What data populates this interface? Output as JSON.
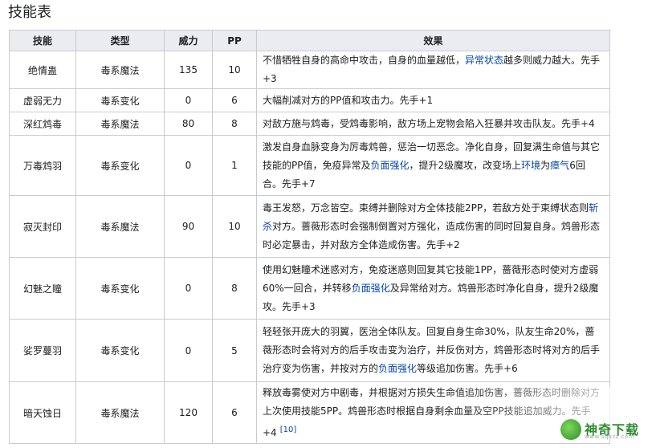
{
  "section_title": "技能表",
  "headers": {
    "skill": "技能",
    "type": "类型",
    "power": "威力",
    "pp": "PP",
    "effect": "效果"
  },
  "rows": [
    {
      "name": "绝情蛊",
      "type": "毒系魔法",
      "power": "135",
      "pp": "10",
      "effect": [
        {
          "t": "不惜牺牲自身的高命中攻击，自身的血量越低，"
        },
        {
          "t": "异常状态",
          "link": true
        },
        {
          "t": "越多则威力越大。先手+3"
        }
      ]
    },
    {
      "name": "虚弱无力",
      "type": "毒系变化",
      "power": "0",
      "pp": "6",
      "effect": [
        {
          "t": "大幅削减对方的PP值和攻击力。先手+1"
        }
      ]
    },
    {
      "name": "深红鸩毒",
      "type": "毒系魔法",
      "power": "80",
      "pp": "8",
      "effect": [
        {
          "t": "对敌方施与鸩毒，受鸩毒影响，敌方场上宠物会陷入狂暴并攻击队友。先手+4"
        }
      ]
    },
    {
      "name": "万毒鸩羽",
      "type": "毒系变化",
      "power": "0",
      "pp": "1",
      "effect": [
        {
          "t": "激发自身血脉变身为厉毒鸩兽，惩治一切恶念。净化自身，回复满生命值与其它技能的PP值，免疫异常及"
        },
        {
          "t": "负面强化",
          "link": true
        },
        {
          "t": "，提升2级魔攻，改变场上"
        },
        {
          "t": "环境",
          "link": true
        },
        {
          "t": "为"
        },
        {
          "t": "瘴气",
          "link": true
        },
        {
          "t": "6回合。先手+7"
        }
      ]
    },
    {
      "name": "寂灭封印",
      "type": "毒系魔法",
      "power": "90",
      "pp": "10",
      "effect": [
        {
          "t": "毒王发怒，万念皆空。束缚并删除对方全体技能2PP，若敌方处于束缚状态则"
        },
        {
          "t": "斩杀",
          "link": true
        },
        {
          "t": "对方。蔷薇形态时会强制倒置对方强化，造成伤害的同时回复自身。鸩兽形态时必定暴击，并对敌方全体造成伤害。先手+2"
        }
      ]
    },
    {
      "name": "幻魅之瞳",
      "type": "毒系变化",
      "power": "0",
      "pp": "8",
      "effect": [
        {
          "t": "使用幻魅瞳术迷惑对方，免疫迷惑则回复其它技能1PP，蔷薇形态时使对方虚弱60%一回合，并转移"
        },
        {
          "t": "负面强化",
          "link": true
        },
        {
          "t": "及异常给对方。鸩兽形态时净化自身，提升2级魔攻。先手+3"
        }
      ]
    },
    {
      "name": "娑罗蔓羽",
      "type": "毒系变化",
      "power": "0",
      "pp": "5",
      "effect": [
        {
          "t": "轻轻张开庞大的羽翼，医治全体队友。回复自身生命30%，队友生命20%，蔷薇形态时会将对方的后手攻击变为治疗，并反伤对方，鸩兽形态时将对方的后手治疗变为伤害，并按对方的"
        },
        {
          "t": "负面强化",
          "link": true
        },
        {
          "t": "等级追加伤害。先手+6"
        }
      ]
    },
    {
      "name": "暗天蚀日",
      "type": "毒系魔法",
      "power": "120",
      "pp": "6",
      "effect": [
        {
          "t": "释放毒雾使对方中剧毒，并根据对方损失生命值追加伤害，蔷薇形态时删除对方上次使用技能5PP。鸩兽形态时根据自身剩余血量及空PP技能追加威力。先手+4"
        },
        {
          "t": "[10]",
          "ref": true
        }
      ]
    }
  ],
  "watermark": {
    "brand": "神奇下载",
    "url": "www.sqxzz.com",
    "icon": "leaf-logo-icon"
  }
}
